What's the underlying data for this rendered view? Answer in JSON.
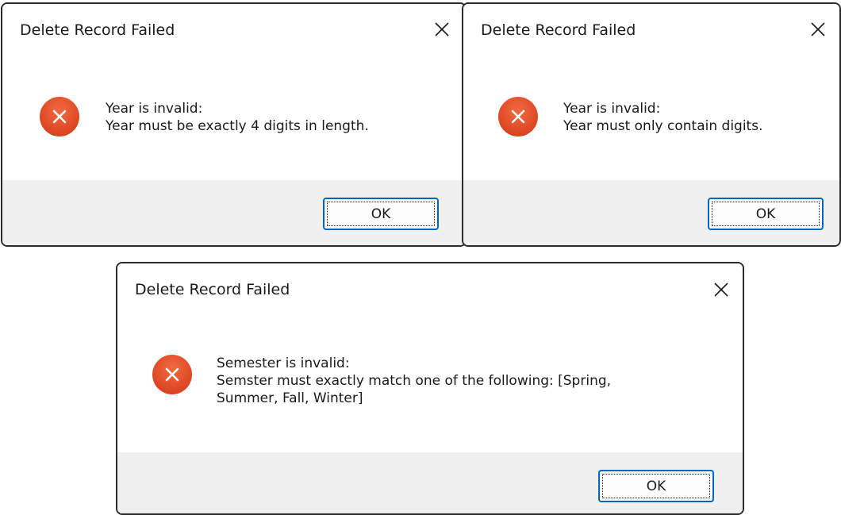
{
  "colors": {
    "error_red": "#e4532f",
    "accent_blue": "#0067c0",
    "footer_gray": "#f0f0f0"
  },
  "icons": {
    "close": "close-icon",
    "error": "error-icon"
  },
  "dialogs": [
    {
      "title": "Delete Record Failed",
      "message_lines": [
        "Year is invalid:",
        "Year must be exactly 4 digits in length."
      ],
      "ok_label": "OK"
    },
    {
      "title": "Delete Record Failed",
      "message_lines": [
        "Year is invalid:",
        "Year must only contain digits."
      ],
      "ok_label": "OK"
    },
    {
      "title": "Delete Record Failed",
      "message_lines": [
        "Semester is invalid:",
        "Semster must exactly match one of the following: [Spring,",
        "Summer, Fall, Winter]"
      ],
      "ok_label": "OK"
    }
  ]
}
